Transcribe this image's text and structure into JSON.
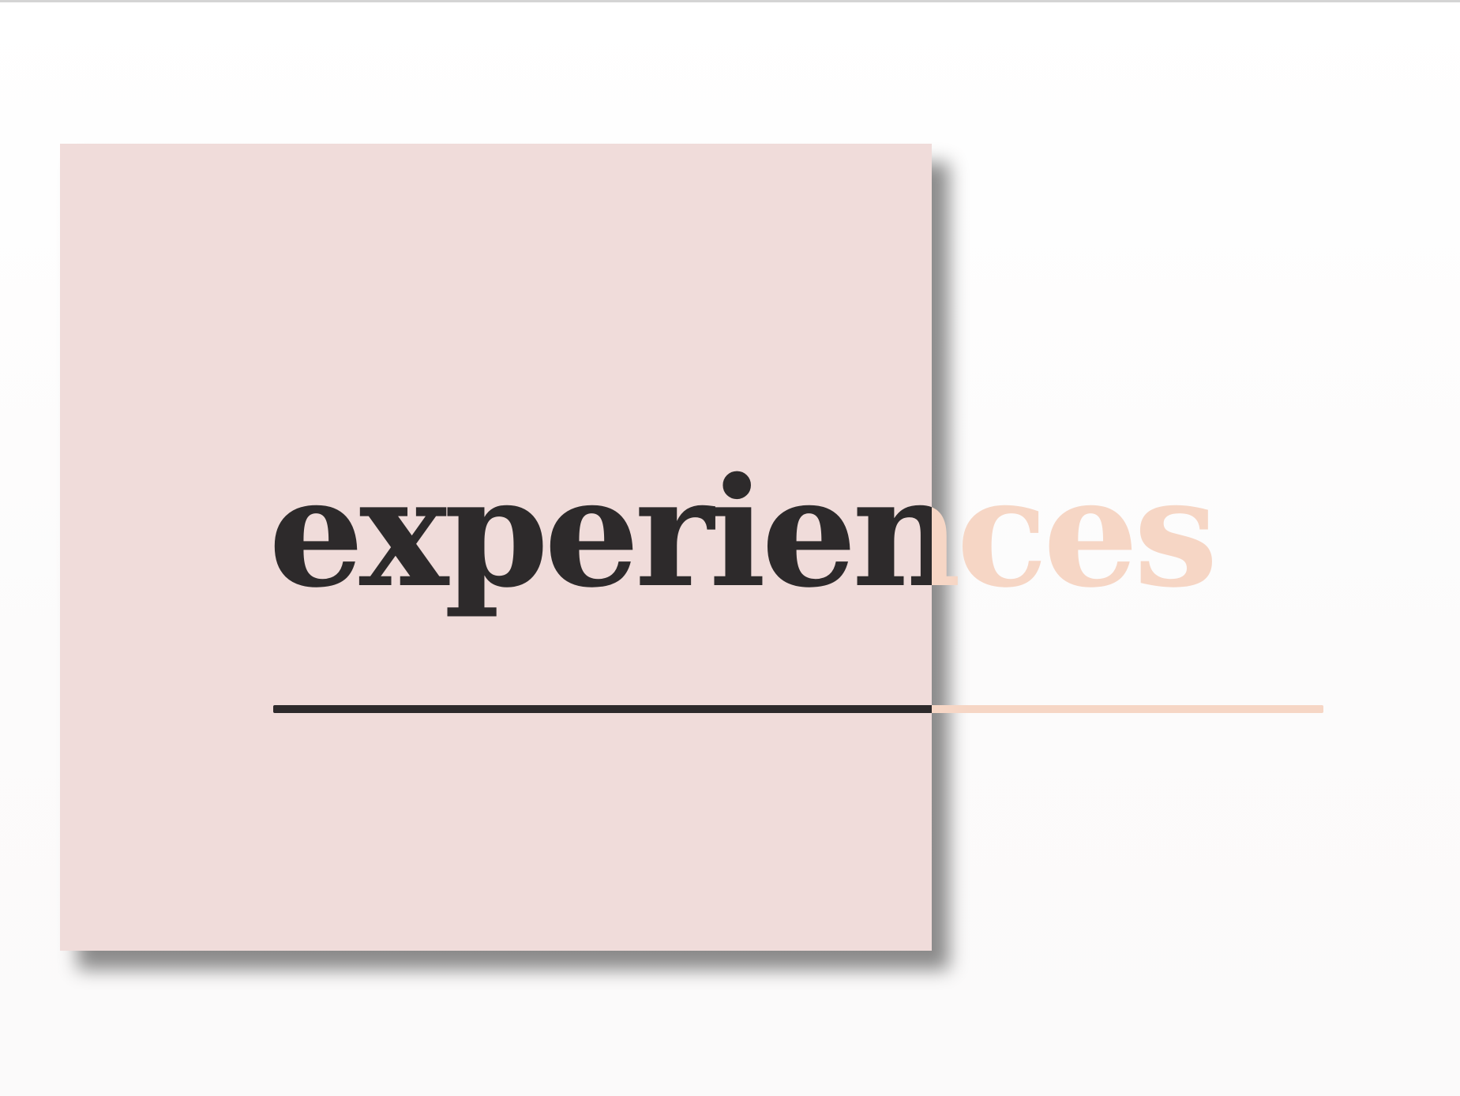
{
  "headline": {
    "word": "experiences",
    "dark_color": "#2d2a2b",
    "light_color": "#f6d6c5"
  },
  "colors": {
    "square": "#f0dcda",
    "background": "#fdfcfc"
  }
}
